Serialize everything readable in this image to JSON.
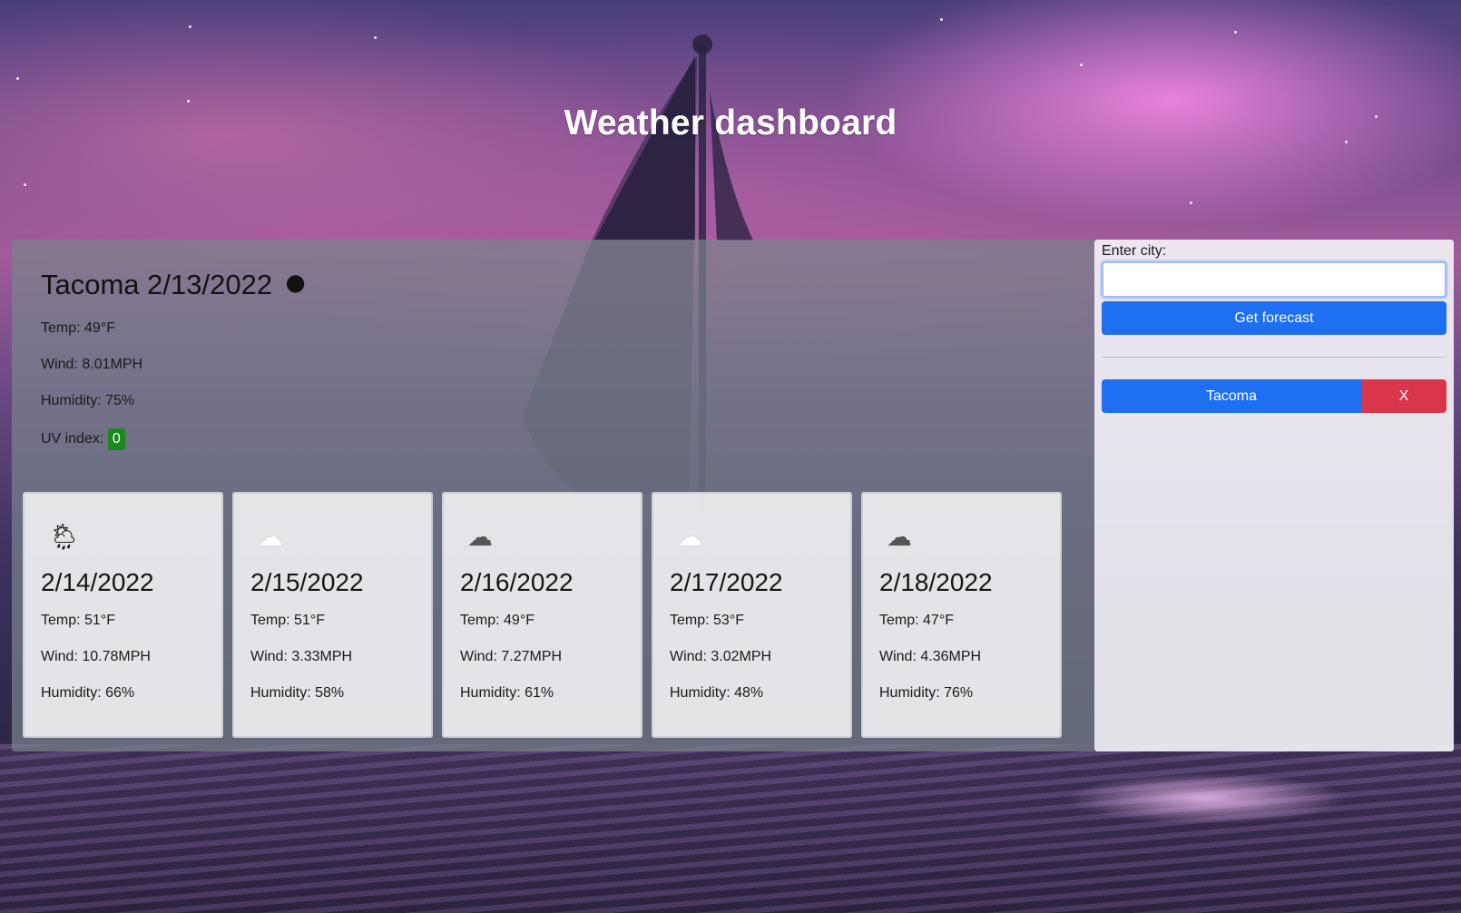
{
  "header": {
    "title": "Weather dashboard"
  },
  "current": {
    "city_date": "Tacoma 2/13/2022",
    "icon": "moon-icon",
    "icon_glyph": "🌑",
    "temp": "Temp: 49°F",
    "wind": "Wind: 8.01MPH",
    "humidity": "Humidity: 75%",
    "uv_label": "UV index:",
    "uv_value": "0",
    "uv_color": "#198a1c"
  },
  "forecast": [
    {
      "date": "2/14/2022",
      "icon": "rain-sun-icon",
      "glyph": "🌦",
      "temp": "Temp: 51°F",
      "wind": "Wind: 10.78MPH",
      "humidity": "Humidity: 66%"
    },
    {
      "date": "2/15/2022",
      "icon": "cloud-icon",
      "glyph": "☁",
      "temp": "Temp: 51°F",
      "wind": "Wind: 3.33MPH",
      "humidity": "Humidity: 58%"
    },
    {
      "date": "2/16/2022",
      "icon": "clouds-icon",
      "glyph": "☁",
      "temp": "Temp: 49°F",
      "wind": "Wind: 7.27MPH",
      "humidity": "Humidity: 61%"
    },
    {
      "date": "2/17/2022",
      "icon": "cloud-icon",
      "glyph": "☁",
      "temp": "Temp: 53°F",
      "wind": "Wind: 3.02MPH",
      "humidity": "Humidity: 48%"
    },
    {
      "date": "2/18/2022",
      "icon": "clouds-icon",
      "glyph": "☁",
      "temp": "Temp: 47°F",
      "wind": "Wind: 4.36MPH",
      "humidity": "Humidity: 76%"
    }
  ],
  "search": {
    "label": "Enter city:",
    "value": "",
    "placeholder": "",
    "button_label": "Get forecast"
  },
  "history": [
    {
      "city": "Tacoma",
      "remove_label": "X"
    }
  ],
  "colors": {
    "primary": "#1f6ff2",
    "danger": "#d9364a",
    "uv_low": "#198a1c"
  }
}
